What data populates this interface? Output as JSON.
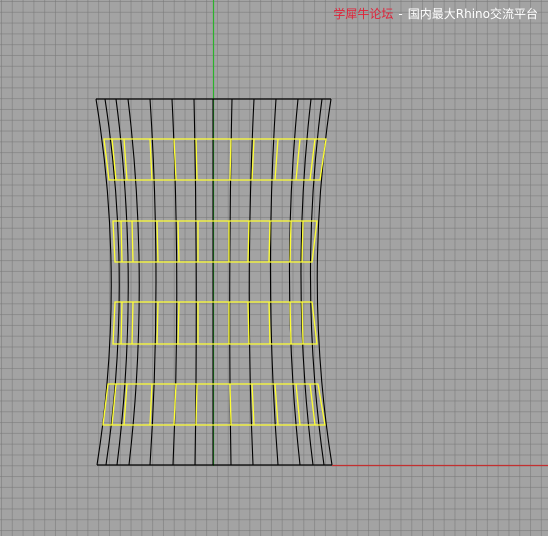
{
  "watermark": {
    "site": "学犀牛论坛",
    "separator": "-",
    "tagline": "国内最大Rhino交流平台"
  },
  "colors": {
    "background": "#a3a3a3",
    "grid": "#7a7a7a",
    "y_axis": "#2bb32b",
    "x_axis": "#c23030",
    "wireframe": "#000000",
    "selected_curves": "#ffff33",
    "watermark_site": "#e0233a",
    "watermark_text": "#ffffff"
  }
}
